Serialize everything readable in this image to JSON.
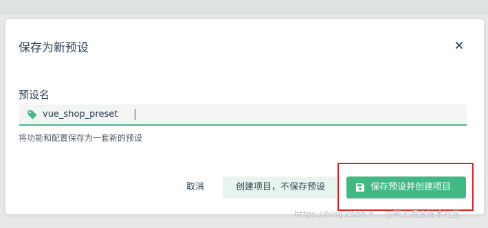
{
  "dialog": {
    "title": "保存为新预设",
    "close_icon": "close-icon",
    "field_label": "预设名",
    "input": {
      "value": "vue_shop_preset",
      "icon": "tag-icon"
    },
    "hint": "将功能和配置保存为一套新的预设",
    "buttons": {
      "cancel_label": "取消",
      "secondary_label": "创建项目，不保存预设",
      "primary_label": "保存预设并创建项目",
      "primary_icon": "save-icon"
    }
  },
  "watermark": "https://blog.csdn.n...  @稀土掘金技术社区",
  "colors": {
    "accent": "#42b983",
    "accent_light": "#e8f5ef",
    "highlight": "#e02020",
    "text": "#2c3e50"
  }
}
